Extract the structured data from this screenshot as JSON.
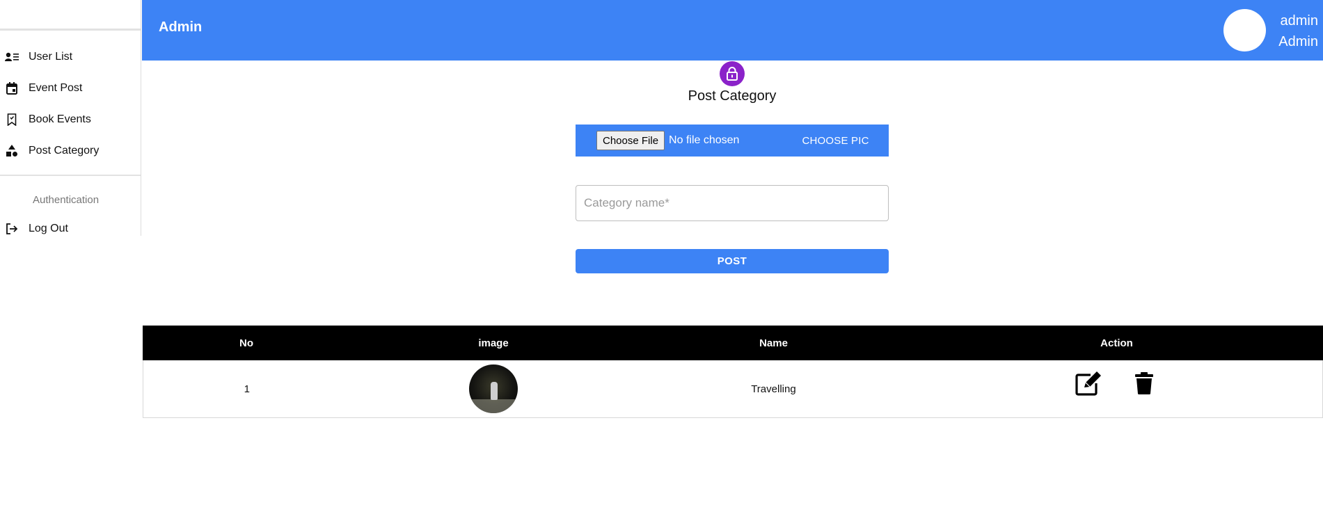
{
  "sidebar": {
    "items": [
      {
        "label": "User List",
        "icon": "user-list-icon"
      },
      {
        "label": "Event Post",
        "icon": "calendar-icon"
      },
      {
        "label": "Book Events",
        "icon": "bookmark-icon"
      },
      {
        "label": "Post Category",
        "icon": "shapes-icon"
      }
    ],
    "section_label": "Authentication",
    "logout_label": "Log Out"
  },
  "header": {
    "title": "Admin",
    "username": "admin",
    "role": "Admin",
    "bg_color": "#3d83f5"
  },
  "form": {
    "title": "Post Category",
    "file_button_label": "Choose File",
    "file_status": "No file chosen",
    "choose_pic_label": "CHOOSE PIC",
    "category_placeholder": "Category name*",
    "category_value": "",
    "post_label": "POST",
    "badge_color": "#8b22c9"
  },
  "table": {
    "headers": [
      "No",
      "image",
      "Name",
      "Action"
    ],
    "rows": [
      {
        "no": "1",
        "name": "Travelling"
      }
    ]
  }
}
